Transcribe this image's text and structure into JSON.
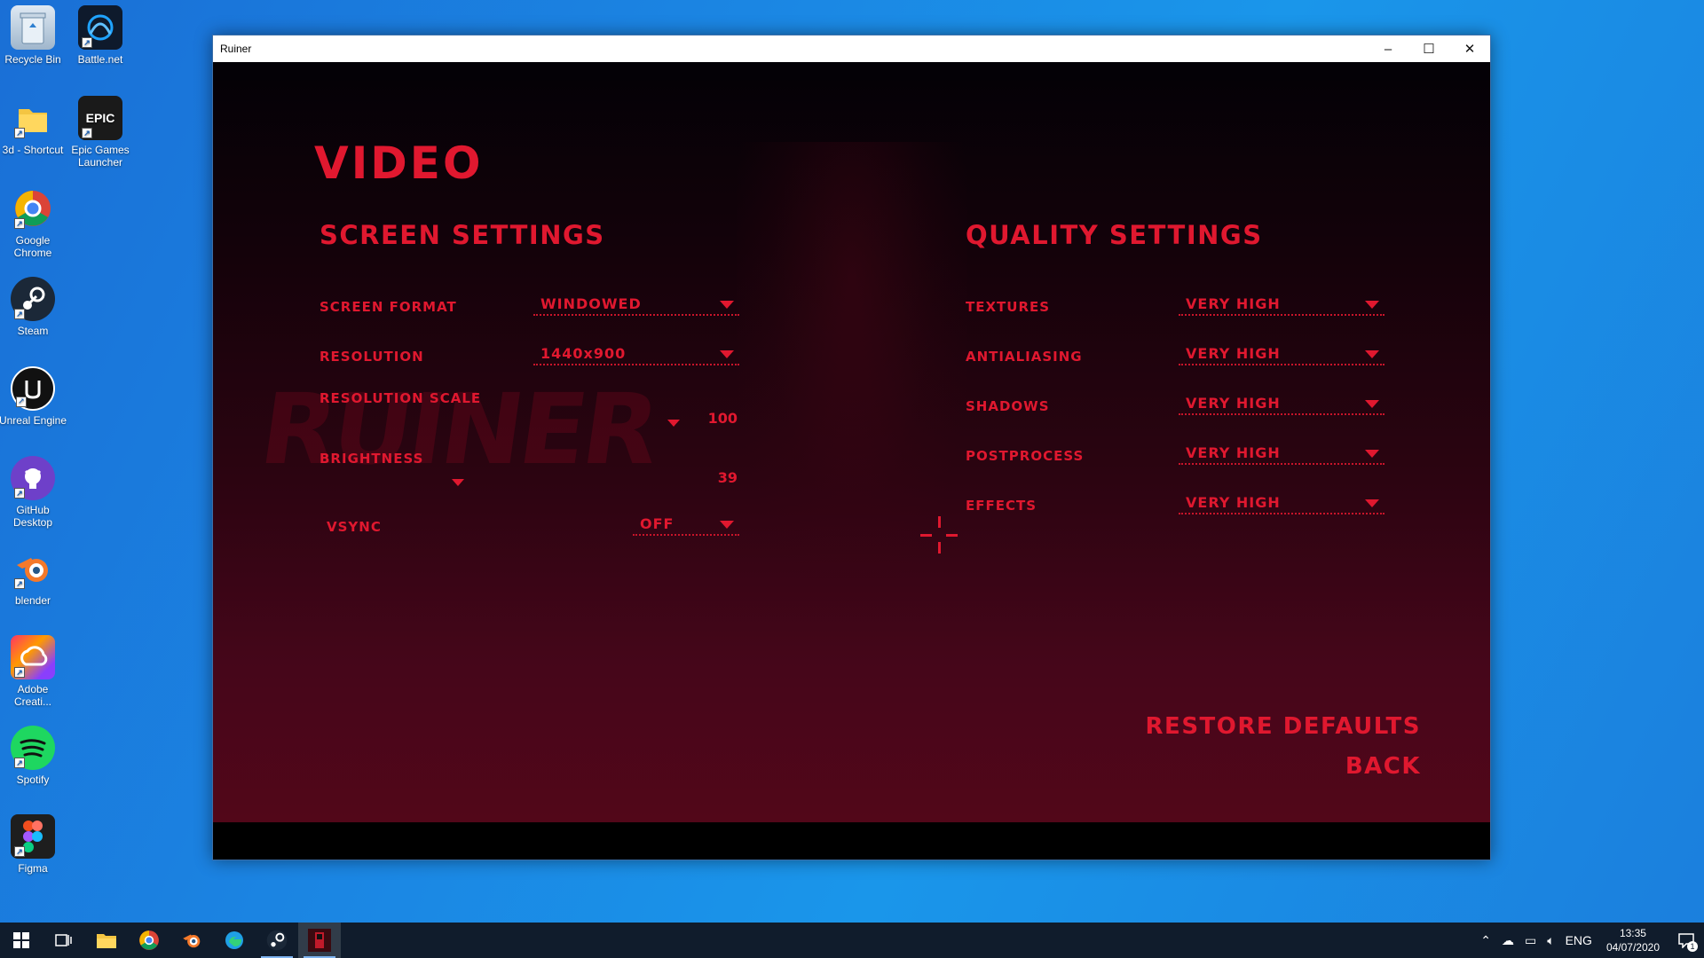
{
  "desktop": {
    "icons": [
      {
        "label": "Recycle Bin"
      },
      {
        "label": "Battle.net"
      },
      {
        "label": "3d - Shortcut"
      },
      {
        "label": "Epic Games Launcher",
        "glyph": "EPIC"
      },
      {
        "label": "Google Chrome"
      },
      {
        "label": "Steam"
      },
      {
        "label": "Unreal Engine"
      },
      {
        "label": "GitHub Desktop"
      },
      {
        "label": "blender"
      },
      {
        "label": "Adobe Creati..."
      },
      {
        "label": "Spotify"
      },
      {
        "label": "Figma"
      }
    ]
  },
  "window": {
    "title": "Ruiner",
    "controls": {
      "minimize": "–",
      "maximize": "☐",
      "close": "✕"
    }
  },
  "game": {
    "heading": "VIDEO",
    "screen_settings": {
      "title": "SCREEN SETTINGS",
      "screen_format": {
        "label": "SCREEN FORMAT",
        "value": "WINDOWED"
      },
      "resolution": {
        "label": "RESOLUTION",
        "value": "1440x900"
      },
      "resolution_scale": {
        "label": "RESOLUTION SCALE",
        "value": "100"
      },
      "brightness": {
        "label": "BRIGHTNESS",
        "value": "39"
      },
      "vsync": {
        "label": "VSYNC",
        "value": "OFF"
      }
    },
    "quality_settings": {
      "title": "QUALITY SETTINGS",
      "textures": {
        "label": "TEXTURES",
        "value": "VERY HIGH"
      },
      "antialiasing": {
        "label": "ANTIALIASING",
        "value": "VERY HIGH"
      },
      "shadows": {
        "label": "SHADOWS",
        "value": "VERY HIGH"
      },
      "postprocess": {
        "label": "POSTPROCESS",
        "value": "VERY HIGH"
      },
      "effects": {
        "label": "EFFECTS",
        "value": "VERY HIGH"
      }
    },
    "restore_defaults": "RESTORE DEFAULTS",
    "back": "BACK",
    "accent_color": "#e0182f"
  },
  "taskbar": {
    "language": "ENG",
    "time": "13:35",
    "date": "04/07/2020",
    "notifications": "1"
  }
}
